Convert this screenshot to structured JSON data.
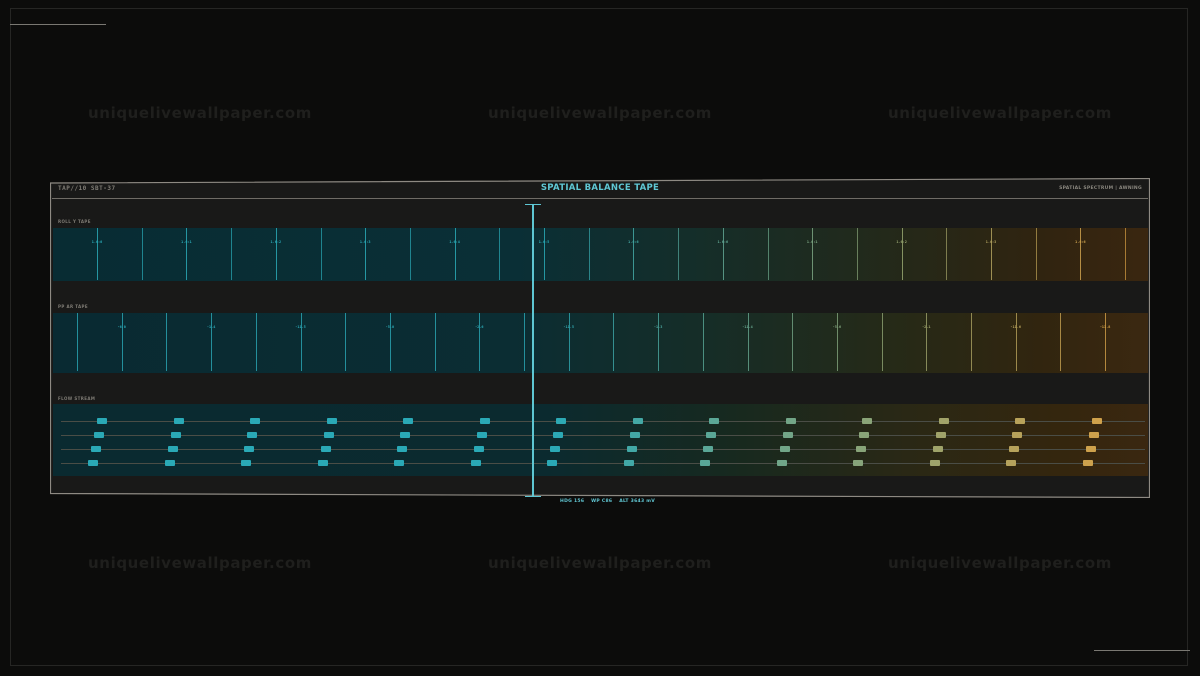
{
  "watermark": "uniquelivewallpaper.com",
  "header": {
    "left": "TAP//10 SBT-37",
    "title": "SPATIAL BALANCE TAPE",
    "right": "SPATIAL SPECTRUM | AWNING"
  },
  "sections": {
    "roll": {
      "label": "ROLL Y TAPE",
      "ticks": [
        "1.6:0",
        "1.6:1",
        "1.6:2",
        "1.6:3",
        "1.6:4",
        "1.6:5",
        "1.6:6",
        "1.6:6",
        "1.6:1",
        "1.6:2",
        "1.6:3",
        "1.6:6"
      ]
    },
    "pitch": {
      "label": "PP AR TAPE",
      "ticks": [
        "-6.0",
        "-1.4",
        "-11.5",
        "-5.0",
        "-2.6",
        "-11.5",
        "-1.3",
        "-11.4",
        "-5.6",
        "-2.1",
        "-11.6",
        "-11.8"
      ]
    },
    "flow": {
      "label": "FLOW STREAM"
    }
  },
  "readout": {
    "hdg": "HDG 156",
    "wp": "WP C86",
    "alt": "ALT 3643 mV"
  },
  "colors": {
    "accent": "#5fc7d4",
    "cyan": "#2aa9b6",
    "amber": "#e0a040"
  }
}
